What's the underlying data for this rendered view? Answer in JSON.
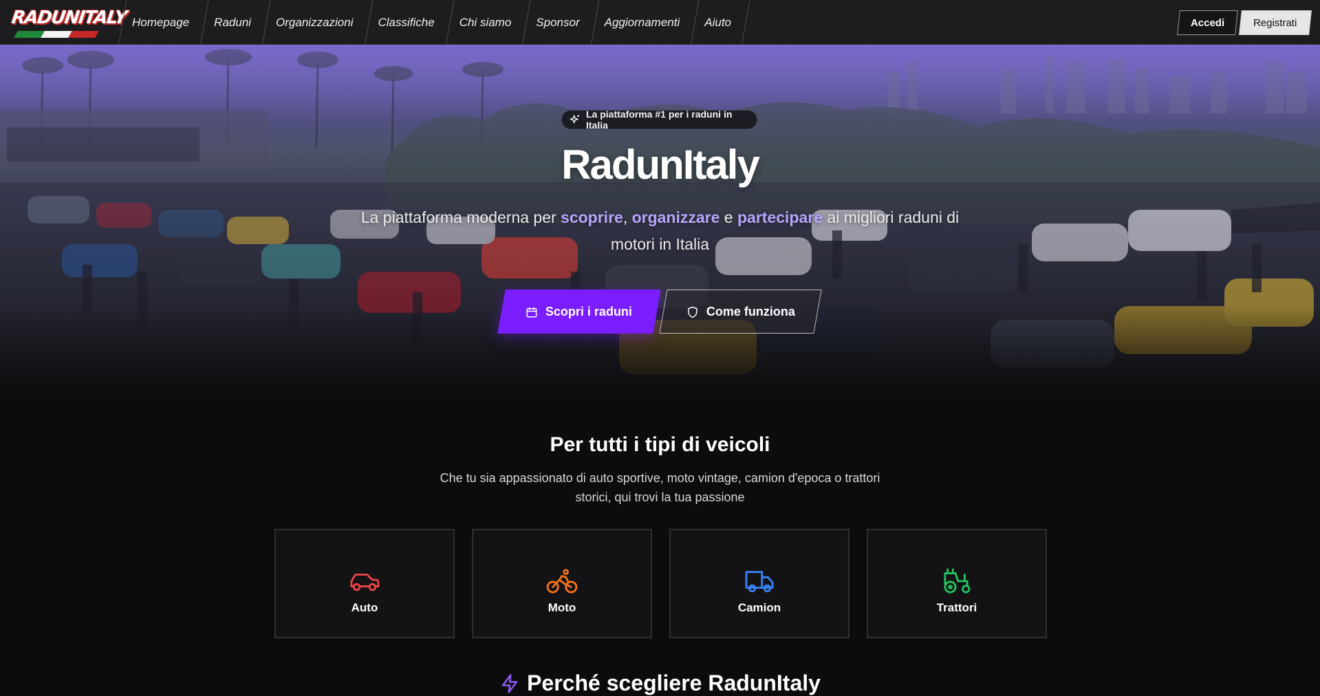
{
  "nav": {
    "logo_text": "RADUNITALY",
    "links": [
      "Homepage",
      "Raduni",
      "Organizzazioni",
      "Classifiche",
      "Chi siamo",
      "Sponsor",
      "Aggiornamenti",
      "Aiuto"
    ],
    "login_label": "Accedi",
    "register_label": "Registrati"
  },
  "hero": {
    "badge": "La piattaforma #1 per i raduni in Italia",
    "title": "RadunItaly",
    "subtitle": {
      "pre": "La piattaforma moderna per ",
      "h1": "scoprire",
      "sep1": ", ",
      "h2": "organizzare",
      "sep2": " e ",
      "h3": "partecipare",
      "post": " ai migliori raduni di motori in Italia"
    },
    "primary_button": "Scopri i raduni",
    "secondary_button": "Come funziona"
  },
  "vehicles": {
    "title": "Per tutti i tipi di veicoli",
    "description": "Che tu sia appassionato di auto sportive, moto vintage, camion d'epoca o trattori storici, qui trovi la tua passione",
    "cards": [
      {
        "label": "Auto",
        "icon": "car-icon",
        "color": "#ef4444"
      },
      {
        "label": "Moto",
        "icon": "bike-icon",
        "color": "#f97316"
      },
      {
        "label": "Camion",
        "icon": "truck-icon",
        "color": "#3b82f6"
      },
      {
        "label": "Trattori",
        "icon": "tractor-icon",
        "color": "#22c55e"
      }
    ]
  },
  "next_section": {
    "title": "Perché scegliere RadunItaly"
  },
  "colors": {
    "accent": "#7a1dff",
    "highlight": "#b9a4ff",
    "background": "#0c0c0e"
  }
}
